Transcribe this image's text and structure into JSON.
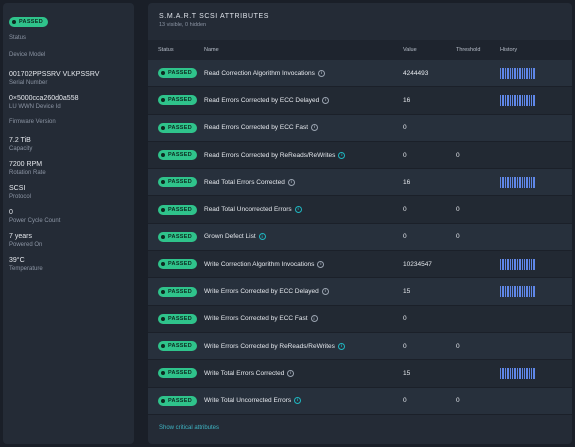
{
  "sidebar": {
    "status_badge": "PASSED",
    "status_label": "Status",
    "device_model_label": "Device Model",
    "fields": [
      {
        "value": "001702PPSSRV VLKPSSRV",
        "label": "Serial Number"
      },
      {
        "value": "0×5000cca260d0a558",
        "label": "LU WWN Device Id"
      }
    ],
    "firmware_label": "Firmware Version",
    "fields2": [
      {
        "value": "7.2 TiB",
        "label": "Capacity"
      },
      {
        "value": "7200 RPM",
        "label": "Rotation Rate"
      },
      {
        "value": "SCSI",
        "label": "Protocol"
      },
      {
        "value": "0",
        "label": "Power Cycle Count"
      },
      {
        "value": "7 years",
        "label": "Powered On"
      },
      {
        "value": "39°C",
        "label": "Temperature"
      }
    ]
  },
  "panel": {
    "title": "S.M.A.R.T SCSI ATTRIBUTES",
    "subtitle": "13 visible, 0 hidden",
    "columns": {
      "status": "Status",
      "name": "Name",
      "value": "Value",
      "threshold": "Threshold",
      "history": "History"
    },
    "rows": [
      {
        "status": "PASSED",
        "name": "Read Correction Algorithm Invocations",
        "info_color": "gray",
        "value": "4244493",
        "threshold": "",
        "history": true
      },
      {
        "status": "PASSED",
        "name": "Read Errors Corrected by ECC Delayed",
        "info_color": "gray",
        "value": "16",
        "threshold": "",
        "history": true
      },
      {
        "status": "PASSED",
        "name": "Read Errors Corrected by ECC Fast",
        "info_color": "gray",
        "value": "0",
        "threshold": "",
        "history": false
      },
      {
        "status": "PASSED",
        "name": "Read Errors Corrected by ReReads/ReWrites",
        "info_color": "teal",
        "value": "0",
        "threshold": "0",
        "history": false
      },
      {
        "status": "PASSED",
        "name": "Read Total Errors Corrected",
        "info_color": "gray",
        "value": "16",
        "threshold": "",
        "history": true
      },
      {
        "status": "PASSED",
        "name": "Read Total Uncorrected Errors",
        "info_color": "teal",
        "value": "0",
        "threshold": "0",
        "history": false
      },
      {
        "status": "PASSED",
        "name": "Grown Defect List",
        "info_color": "teal",
        "value": "0",
        "threshold": "0",
        "history": false
      },
      {
        "status": "PASSED",
        "name": "Write Correction Algorithm Invocations",
        "info_color": "gray",
        "value": "10234547",
        "threshold": "",
        "history": true
      },
      {
        "status": "PASSED",
        "name": "Write Errors Corrected by ECC Delayed",
        "info_color": "gray",
        "value": "15",
        "threshold": "",
        "history": true
      },
      {
        "status": "PASSED",
        "name": "Write Errors Corrected by ECC Fast",
        "info_color": "gray",
        "value": "0",
        "threshold": "",
        "history": false
      },
      {
        "status": "PASSED",
        "name": "Write Errors Corrected by ReReads/ReWrites",
        "info_color": "teal",
        "value": "0",
        "threshold": "0",
        "history": false
      },
      {
        "status": "PASSED",
        "name": "Write Total Errors Corrected",
        "info_color": "gray",
        "value": "15",
        "threshold": "",
        "history": true
      },
      {
        "status": "PASSED",
        "name": "Write Total Uncorrected Errors",
        "info_color": "teal",
        "value": "0",
        "threshold": "0",
        "history": false
      }
    ],
    "footer_link": "Show critical attributes"
  },
  "colors": {
    "passed_green": "#2fc38b",
    "history_bar": "#5f87e8",
    "link_teal": "#3fb5c4",
    "info_teal": "#1fb6c0"
  },
  "icons": {
    "info": "info-icon",
    "status_dot": "status-dot-icon"
  }
}
